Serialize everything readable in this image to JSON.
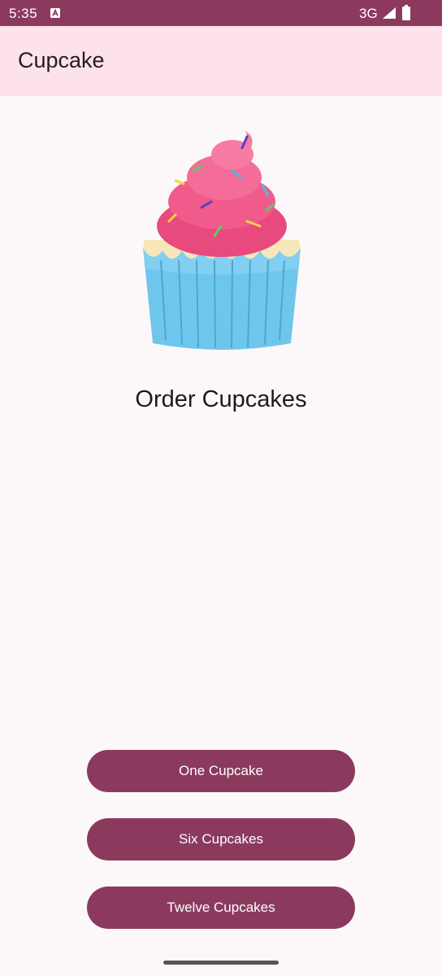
{
  "status_bar": {
    "time": "5:35",
    "network": "3G",
    "icons": [
      "notification-a-icon",
      "signal-icon",
      "battery-icon"
    ]
  },
  "app_bar": {
    "title": "Cupcake"
  },
  "main": {
    "image": "cupcake-image",
    "heading": "Order Cupcakes"
  },
  "buttons": {
    "one": "One Cupcake",
    "six": "Six Cupcakes",
    "twelve": "Twelve Cupcakes"
  },
  "colors": {
    "primary": "#8b3a5e",
    "app_bar_bg": "#fde2ec",
    "background": "#fcf8fa"
  }
}
